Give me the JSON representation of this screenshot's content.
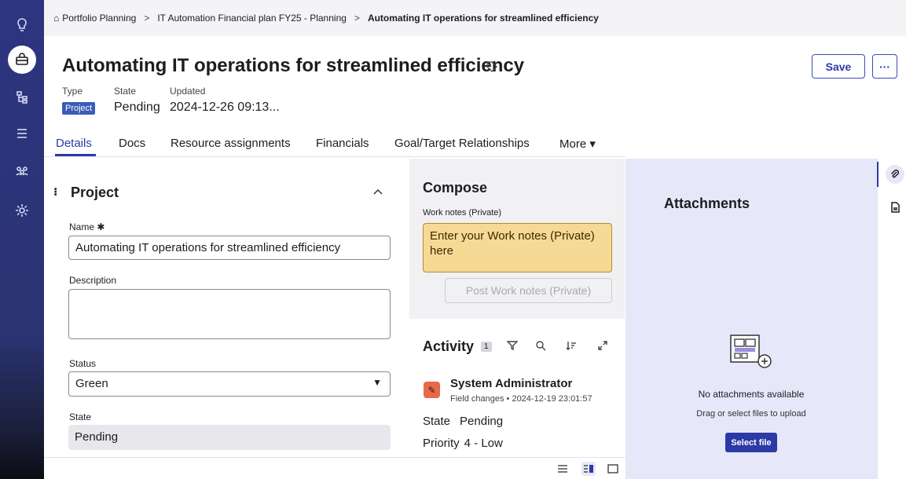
{
  "breadcrumb": {
    "items": [
      "Portfolio Planning",
      "IT Automation Financial plan FY25 - Planning",
      "Automating IT operations for streamlined efficiency"
    ],
    "separator": ">"
  },
  "header": {
    "title": "Automating IT operations for streamlined efficiency",
    "save_label": "Save",
    "more_label": "···",
    "meta": {
      "type_label": "Type",
      "type_value": "Project",
      "state_label": "State",
      "state_value": "Pending",
      "updated_label": "Updated",
      "updated_value": "2024-12-26 09:13..."
    }
  },
  "tabs": [
    {
      "label": "Details",
      "active": true
    },
    {
      "label": "Docs"
    },
    {
      "label": "Resource assignments"
    },
    {
      "label": "Financials"
    },
    {
      "label": "Goal/Target Relationships"
    },
    {
      "label": "More ▾"
    }
  ],
  "form": {
    "section_title": "Project",
    "name_label": "Name ✱",
    "name_value": "Automating IT operations for streamlined efficiency",
    "description_label": "Description",
    "description_value": "",
    "status_label": "Status",
    "status_value": "Green",
    "state_label": "State",
    "state_value": "Pending"
  },
  "compose": {
    "title": "Compose",
    "field_label": "Work notes (Private)",
    "placeholder": "Enter your Work notes (Private) here",
    "post_label": "Post Work notes (Private)"
  },
  "activity": {
    "title": "Activity",
    "count": "1",
    "entry": {
      "author": "System Administrator",
      "meta": "Field changes • 2024-12-19 23:01:57",
      "fields": [
        {
          "name": "State",
          "value": "Pending"
        },
        {
          "name": "Priority",
          "value": "4 - Low"
        }
      ]
    }
  },
  "attachments": {
    "title": "Attachments",
    "empty_text": "No attachments available",
    "hint": "Drag or select files to upload",
    "select_label": "Select file"
  },
  "colors": {
    "brand": "#2c3aa6",
    "rail": "#2d3580",
    "worknotes_bg": "#f7d996",
    "attach_bg": "#e7e7fa"
  }
}
